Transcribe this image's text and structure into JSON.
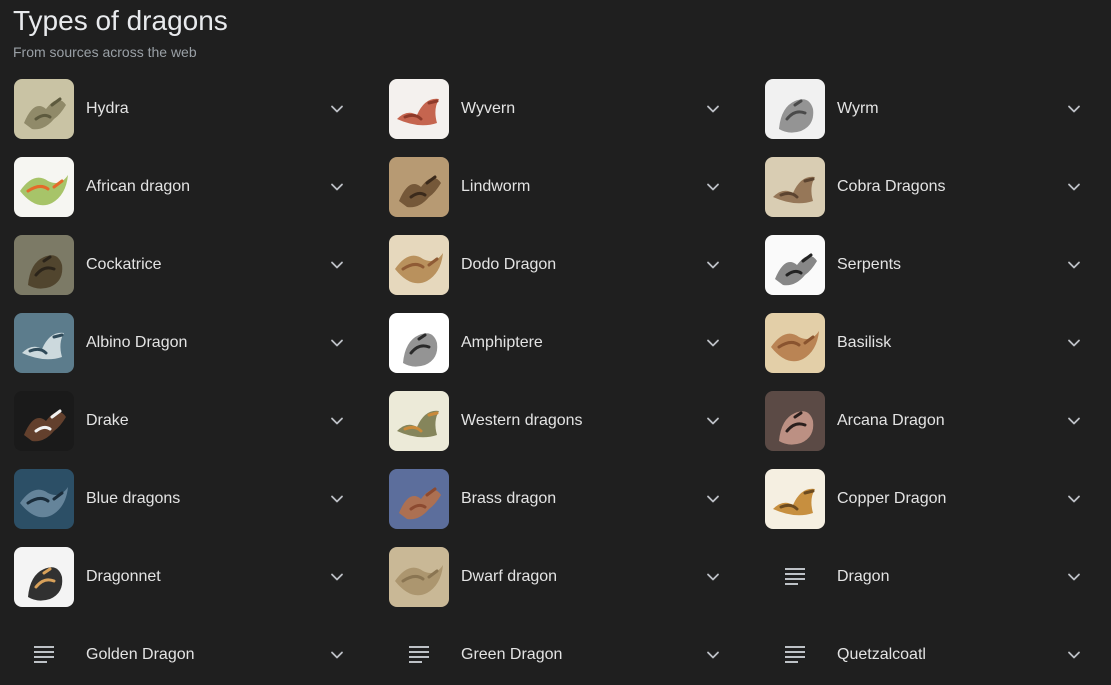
{
  "header": {
    "title": "Types of dragons",
    "subtitle": "From sources across the web"
  },
  "items": [
    {
      "label": "Hydra",
      "thumb": "hydra",
      "colors": [
        "#c9c3a4",
        "#8a8463",
        "#5d5a3e"
      ]
    },
    {
      "label": "Wyvern",
      "thumb": "wyvern",
      "colors": [
        "#f4f1ee",
        "#c0553d",
        "#8e3a2a"
      ]
    },
    {
      "label": "Wyrm",
      "thumb": "wyrm",
      "colors": [
        "#f1f1f1",
        "#8a8a8a",
        "#4a4a4a"
      ]
    },
    {
      "label": "African dragon",
      "thumb": "african",
      "colors": [
        "#f6f6f2",
        "#9fbf5a",
        "#e46a2a"
      ]
    },
    {
      "label": "Lindworm",
      "thumb": "lindworm",
      "colors": [
        "#b79a73",
        "#6e5133",
        "#3b2a1b"
      ]
    },
    {
      "label": "Cobra Dragons",
      "thumb": "cobra",
      "colors": [
        "#d9cdb3",
        "#8e6e4e",
        "#5c4430"
      ]
    },
    {
      "label": "Cockatrice",
      "thumb": "cockatrice",
      "colors": [
        "#7c7a66",
        "#4d3f28",
        "#2b241a"
      ]
    },
    {
      "label": "Dodo Dragon",
      "thumb": "dodo",
      "colors": [
        "#e6d8bd",
        "#b48a52",
        "#8f5b35"
      ]
    },
    {
      "label": "Serpents",
      "thumb": "serpents",
      "colors": [
        "#fafafa",
        "#7a7a7a",
        "#222222"
      ]
    },
    {
      "label": "Albino Dragon",
      "thumb": "albino",
      "colors": [
        "#5c7c8c",
        "#d8e3e6",
        "#304b5a"
      ]
    },
    {
      "label": "Amphiptere",
      "thumb": "amphiptere",
      "colors": [
        "#ffffff",
        "#888888",
        "#2a2a2a"
      ]
    },
    {
      "label": "Basilisk",
      "thumb": "basilisk",
      "colors": [
        "#e3cfa8",
        "#b57b4a",
        "#8a542f"
      ]
    },
    {
      "label": "Drake",
      "thumb": "drake",
      "colors": [
        "#1a1a1a",
        "#6b4530",
        "#f2f2f2"
      ]
    },
    {
      "label": "Western dragons",
      "thumb": "western",
      "colors": [
        "#ecead8",
        "#7a7a4e",
        "#c98a3a"
      ]
    },
    {
      "label": "Arcana Dragon",
      "thumb": "arcana",
      "colors": [
        "#5b4a45",
        "#c7988a",
        "#2a1f1d"
      ]
    },
    {
      "label": "Blue dragons",
      "thumb": "blue",
      "colors": [
        "#2c4f66",
        "#6b8aa0",
        "#1a2c3a"
      ]
    },
    {
      "label": "Brass dragon",
      "thumb": "brass",
      "colors": [
        "#5c6e9c",
        "#b5704a",
        "#8c4a30"
      ]
    },
    {
      "label": "Copper Dragon",
      "thumb": "copper",
      "colors": [
        "#f5efe1",
        "#c2842e",
        "#6b4a1f"
      ]
    },
    {
      "label": "Dragonnet",
      "thumb": "dragonnet",
      "colors": [
        "#f4f4f4",
        "#1c1c1c",
        "#d8a15a"
      ]
    },
    {
      "label": "Dwarf dragon",
      "thumb": "dwarf",
      "colors": [
        "#c9b896",
        "#a8926a",
        "#8a7552"
      ]
    },
    {
      "label": "Dragon",
      "thumb": null,
      "colors": []
    },
    {
      "label": "Golden Dragon",
      "thumb": null,
      "colors": []
    },
    {
      "label": "Green Dragon",
      "thumb": null,
      "colors": []
    },
    {
      "label": "Quetzalcoatl",
      "thumb": null,
      "colors": []
    }
  ],
  "icons": {
    "expand": "chevron-down-icon",
    "no_image": "list-lines-icon"
  },
  "theme": {
    "background": "#1f1f1f",
    "text": "#e3e3e3",
    "muted": "#9aa0a6",
    "icon": "#bdc1c6"
  }
}
